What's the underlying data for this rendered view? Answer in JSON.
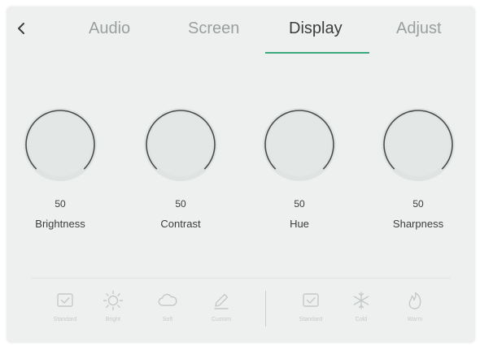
{
  "colors": {
    "panel_bg": "#eef0ef",
    "active_tab_text": "#3a3d3c",
    "inactive_tab_text": "#9aa09e",
    "tab_indicator": "#3aa97c",
    "dial_ring": "#4a4d4c",
    "dial_face": "#e3e7e5",
    "mode_icon": "#c4c9c7"
  },
  "header": {
    "back_icon": "chevron-left-icon",
    "tabs": [
      {
        "label": "Audio",
        "active": false
      },
      {
        "label": "Screen",
        "active": false
      },
      {
        "label": "Display",
        "active": true
      },
      {
        "label": "Adjust",
        "active": false
      }
    ]
  },
  "dials": [
    {
      "label": "Brightness",
      "value": "50"
    },
    {
      "label": "Contrast",
      "value": "50"
    },
    {
      "label": "Hue",
      "value": "50"
    },
    {
      "label": "Sharpness",
      "value": "50"
    }
  ],
  "modes_left": [
    {
      "icon": "check-box-icon",
      "label": "Standard"
    },
    {
      "icon": "sun-icon",
      "label": "Bright"
    },
    {
      "icon": "cloud-icon",
      "label": "Soft"
    },
    {
      "icon": "pen-icon",
      "label": "Custom"
    }
  ],
  "modes_right": [
    {
      "icon": "check-box-icon",
      "label": "Standard"
    },
    {
      "icon": "snowflake-icon",
      "label": "Cold"
    },
    {
      "icon": "flame-icon",
      "label": "Warm"
    }
  ]
}
